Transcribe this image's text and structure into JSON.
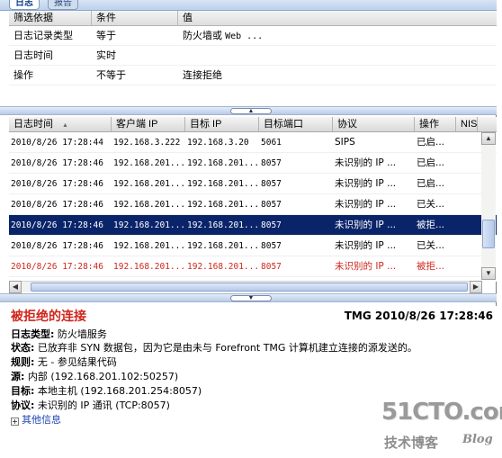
{
  "tabs": [
    {
      "label": "日志"
    },
    {
      "label": "报告"
    }
  ],
  "filter": {
    "headers": [
      "筛选依据",
      "条件",
      "值"
    ],
    "rows": [
      {
        "field": "日志记录类型",
        "cond": "等于",
        "value_cn": "防火墙或 ",
        "value_mono": "Web ..."
      },
      {
        "field": "日志时间",
        "cond": "实时",
        "value_cn": "",
        "value_mono": ""
      },
      {
        "field": "操作",
        "cond": "不等于",
        "value_cn": "连接拒绝",
        "value_mono": ""
      }
    ]
  },
  "grid": {
    "headers": [
      "日志时间",
      "客户端 IP",
      "目标 IP",
      "目标端口",
      "协议",
      "操作",
      "NIS"
    ],
    "rows": [
      {
        "time": "2010/8/26 17:28:44",
        "client": "192.168.3.222",
        "dest": "192.168.3.20",
        "port": "5061",
        "proto": "SIPS",
        "action": "已启...",
        "state": "normal"
      },
      {
        "time": "2010/8/26 17:28:46",
        "client": "192.168.201...",
        "dest": "192.168.201...",
        "port": "8057",
        "proto": "未识别的 IP ...",
        "action": "已启...",
        "state": "normal"
      },
      {
        "time": "2010/8/26 17:28:46",
        "client": "192.168.201...",
        "dest": "192.168.201...",
        "port": "8057",
        "proto": "未识别的 IP ...",
        "action": "已启...",
        "state": "normal"
      },
      {
        "time": "2010/8/26 17:28:46",
        "client": "192.168.201...",
        "dest": "192.168.201...",
        "port": "8057",
        "proto": "未识别的 IP ...",
        "action": "已关...",
        "state": "normal"
      },
      {
        "time": "2010/8/26 17:28:46",
        "client": "192.168.201...",
        "dest": "192.168.201...",
        "port": "8057",
        "proto": "未识别的 IP ...",
        "action": "被拒...",
        "state": "selected"
      },
      {
        "time": "2010/8/26 17:28:46",
        "client": "192.168.201...",
        "dest": "192.168.201...",
        "port": "8057",
        "proto": "未识别的 IP ...",
        "action": "已关...",
        "state": "normal"
      },
      {
        "time": "2010/8/26 17:28:46",
        "client": "192.168.201...",
        "dest": "192.168.201...",
        "port": "8057",
        "proto": "未识别的 IP ...",
        "action": "被拒...",
        "state": "denied"
      }
    ]
  },
  "details": {
    "title": "被拒绝的连接",
    "stamp": "TMG 2010/8/26 17:28:46",
    "lines": [
      {
        "label": "日志类型:",
        "value": "防火墙服务"
      },
      {
        "label": "状态:",
        "value": "已放弃非 SYN 数据包，因为它是由未与 Forefront TMG 计算机建立连接的源发送的。"
      },
      {
        "label": "规则:",
        "value": "无 - 参见结果代码"
      },
      {
        "label": "源:",
        "value": "内部 (192.168.201.102:50257)"
      },
      {
        "label": "目标:",
        "value": "本地主机 (192.168.201.254:8057)"
      },
      {
        "label": "协议:",
        "value": "未识别的 IP 通讯 (TCP:8057)"
      }
    ],
    "more": "其他信息"
  },
  "watermark": {
    "site": "51CTO.com",
    "line2": "技术博客",
    "line3": "Blog"
  },
  "colors": {
    "selected_row": "#0a246a",
    "denied_text": "#d0261d",
    "link": "#1d46b3"
  }
}
